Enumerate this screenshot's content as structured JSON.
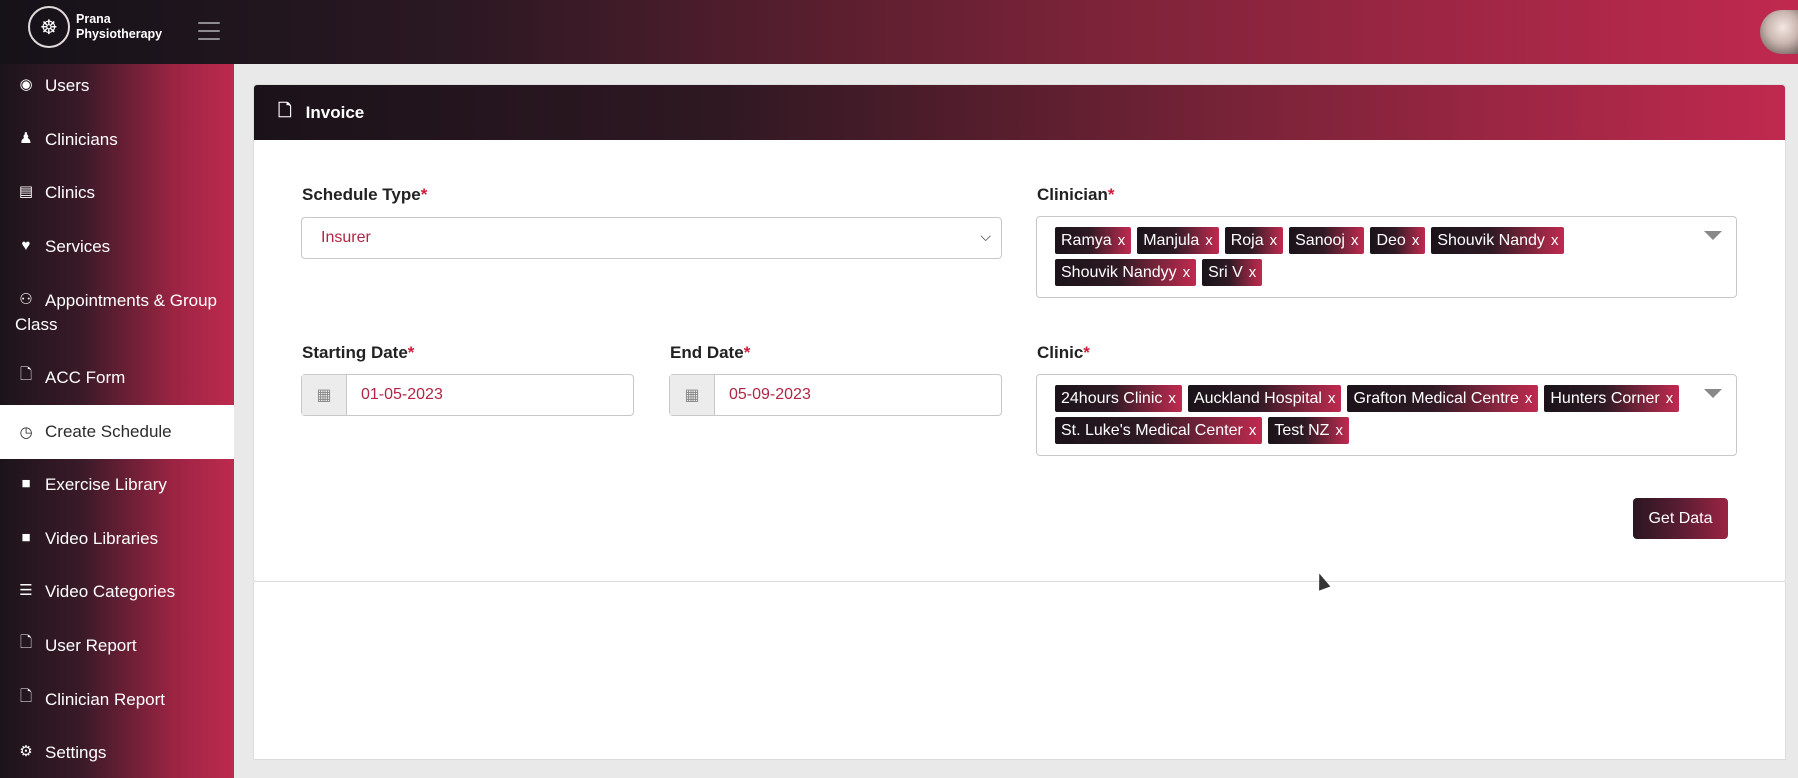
{
  "brand": {
    "name_line1": "Prana",
    "name_line2": "Physiotherapy"
  },
  "sidebar": {
    "items": [
      {
        "label": "Users",
        "icon": "user-circle-icon"
      },
      {
        "label": "Clinicians",
        "icon": "user-doctor-icon"
      },
      {
        "label": "Clinics",
        "icon": "building-icon"
      },
      {
        "label": "Services",
        "icon": "heart-icon"
      },
      {
        "label": "Appointments & Group Class",
        "icon": "users-icon"
      },
      {
        "label": "ACC Form",
        "icon": "file-icon"
      },
      {
        "label": "Create Schedule",
        "icon": "clock-icon"
      },
      {
        "label": "Exercise Library",
        "icon": "video-icon"
      },
      {
        "label": "Video Libraries",
        "icon": "video-icon"
      },
      {
        "label": "Video Categories",
        "icon": "list-icon"
      },
      {
        "label": "User Report",
        "icon": "file-icon"
      },
      {
        "label": "Clinician Report",
        "icon": "file-icon"
      },
      {
        "label": "Settings",
        "icon": "gear-icon"
      }
    ]
  },
  "card": {
    "title": "Invoice"
  },
  "form": {
    "schedule_type": {
      "label": "Schedule Type",
      "required": "*",
      "value": "Insurer"
    },
    "starting_date": {
      "label": "Starting Date",
      "required": "*",
      "value": "01-05-2023"
    },
    "end_date": {
      "label": "End Date",
      "required": "*",
      "value": "05-09-2023"
    },
    "clinician": {
      "label": "Clinician",
      "required": "*",
      "tags": [
        "Ramya",
        "Manjula",
        "Roja",
        "Sanooj",
        "Deo",
        "Shouvik Nandy",
        "Shouvik Nandyy",
        "Sri V"
      ]
    },
    "clinic": {
      "label": "Clinic",
      "required": "*",
      "tags": [
        "24hours Clinic",
        "Auckland Hospital",
        "Grafton Medical Centre",
        "Hunters Corner",
        "St. Luke's Medical Center",
        "Test NZ"
      ]
    },
    "remove_glyph": "x",
    "submit_label": "Get Data"
  },
  "colors": {
    "accent": "#c0294f",
    "dark": "#1b1219",
    "value_text": "#b02545"
  }
}
